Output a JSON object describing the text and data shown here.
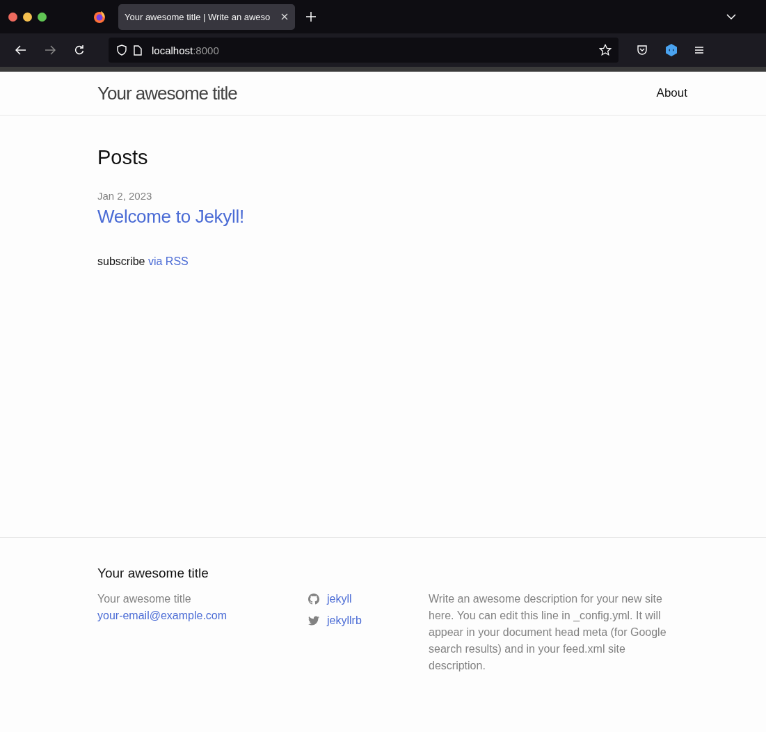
{
  "browser": {
    "tab_title": "Your awesome title | Write an aweso",
    "url_host": "localhost",
    "url_port": ":8000"
  },
  "header": {
    "site_title": "Your awesome title",
    "nav": [
      {
        "label": "About"
      }
    ]
  },
  "main": {
    "heading": "Posts",
    "posts": [
      {
        "date": "Jan 2, 2023",
        "title": "Welcome to Jekyll!"
      }
    ],
    "subscribe_text": "subscribe",
    "subscribe_link": "via RSS"
  },
  "footer": {
    "heading": "Your awesome title",
    "name": "Your awesome title",
    "email": "your-email@example.com",
    "social": [
      {
        "kind": "github",
        "label": "jekyll"
      },
      {
        "kind": "twitter",
        "label": "jekyllrb"
      }
    ],
    "description": "Write an awesome description for your new site here. You can edit this line in _config.yml. It will appear in your document head meta (for Google search results) and in your feed.xml site description."
  }
}
